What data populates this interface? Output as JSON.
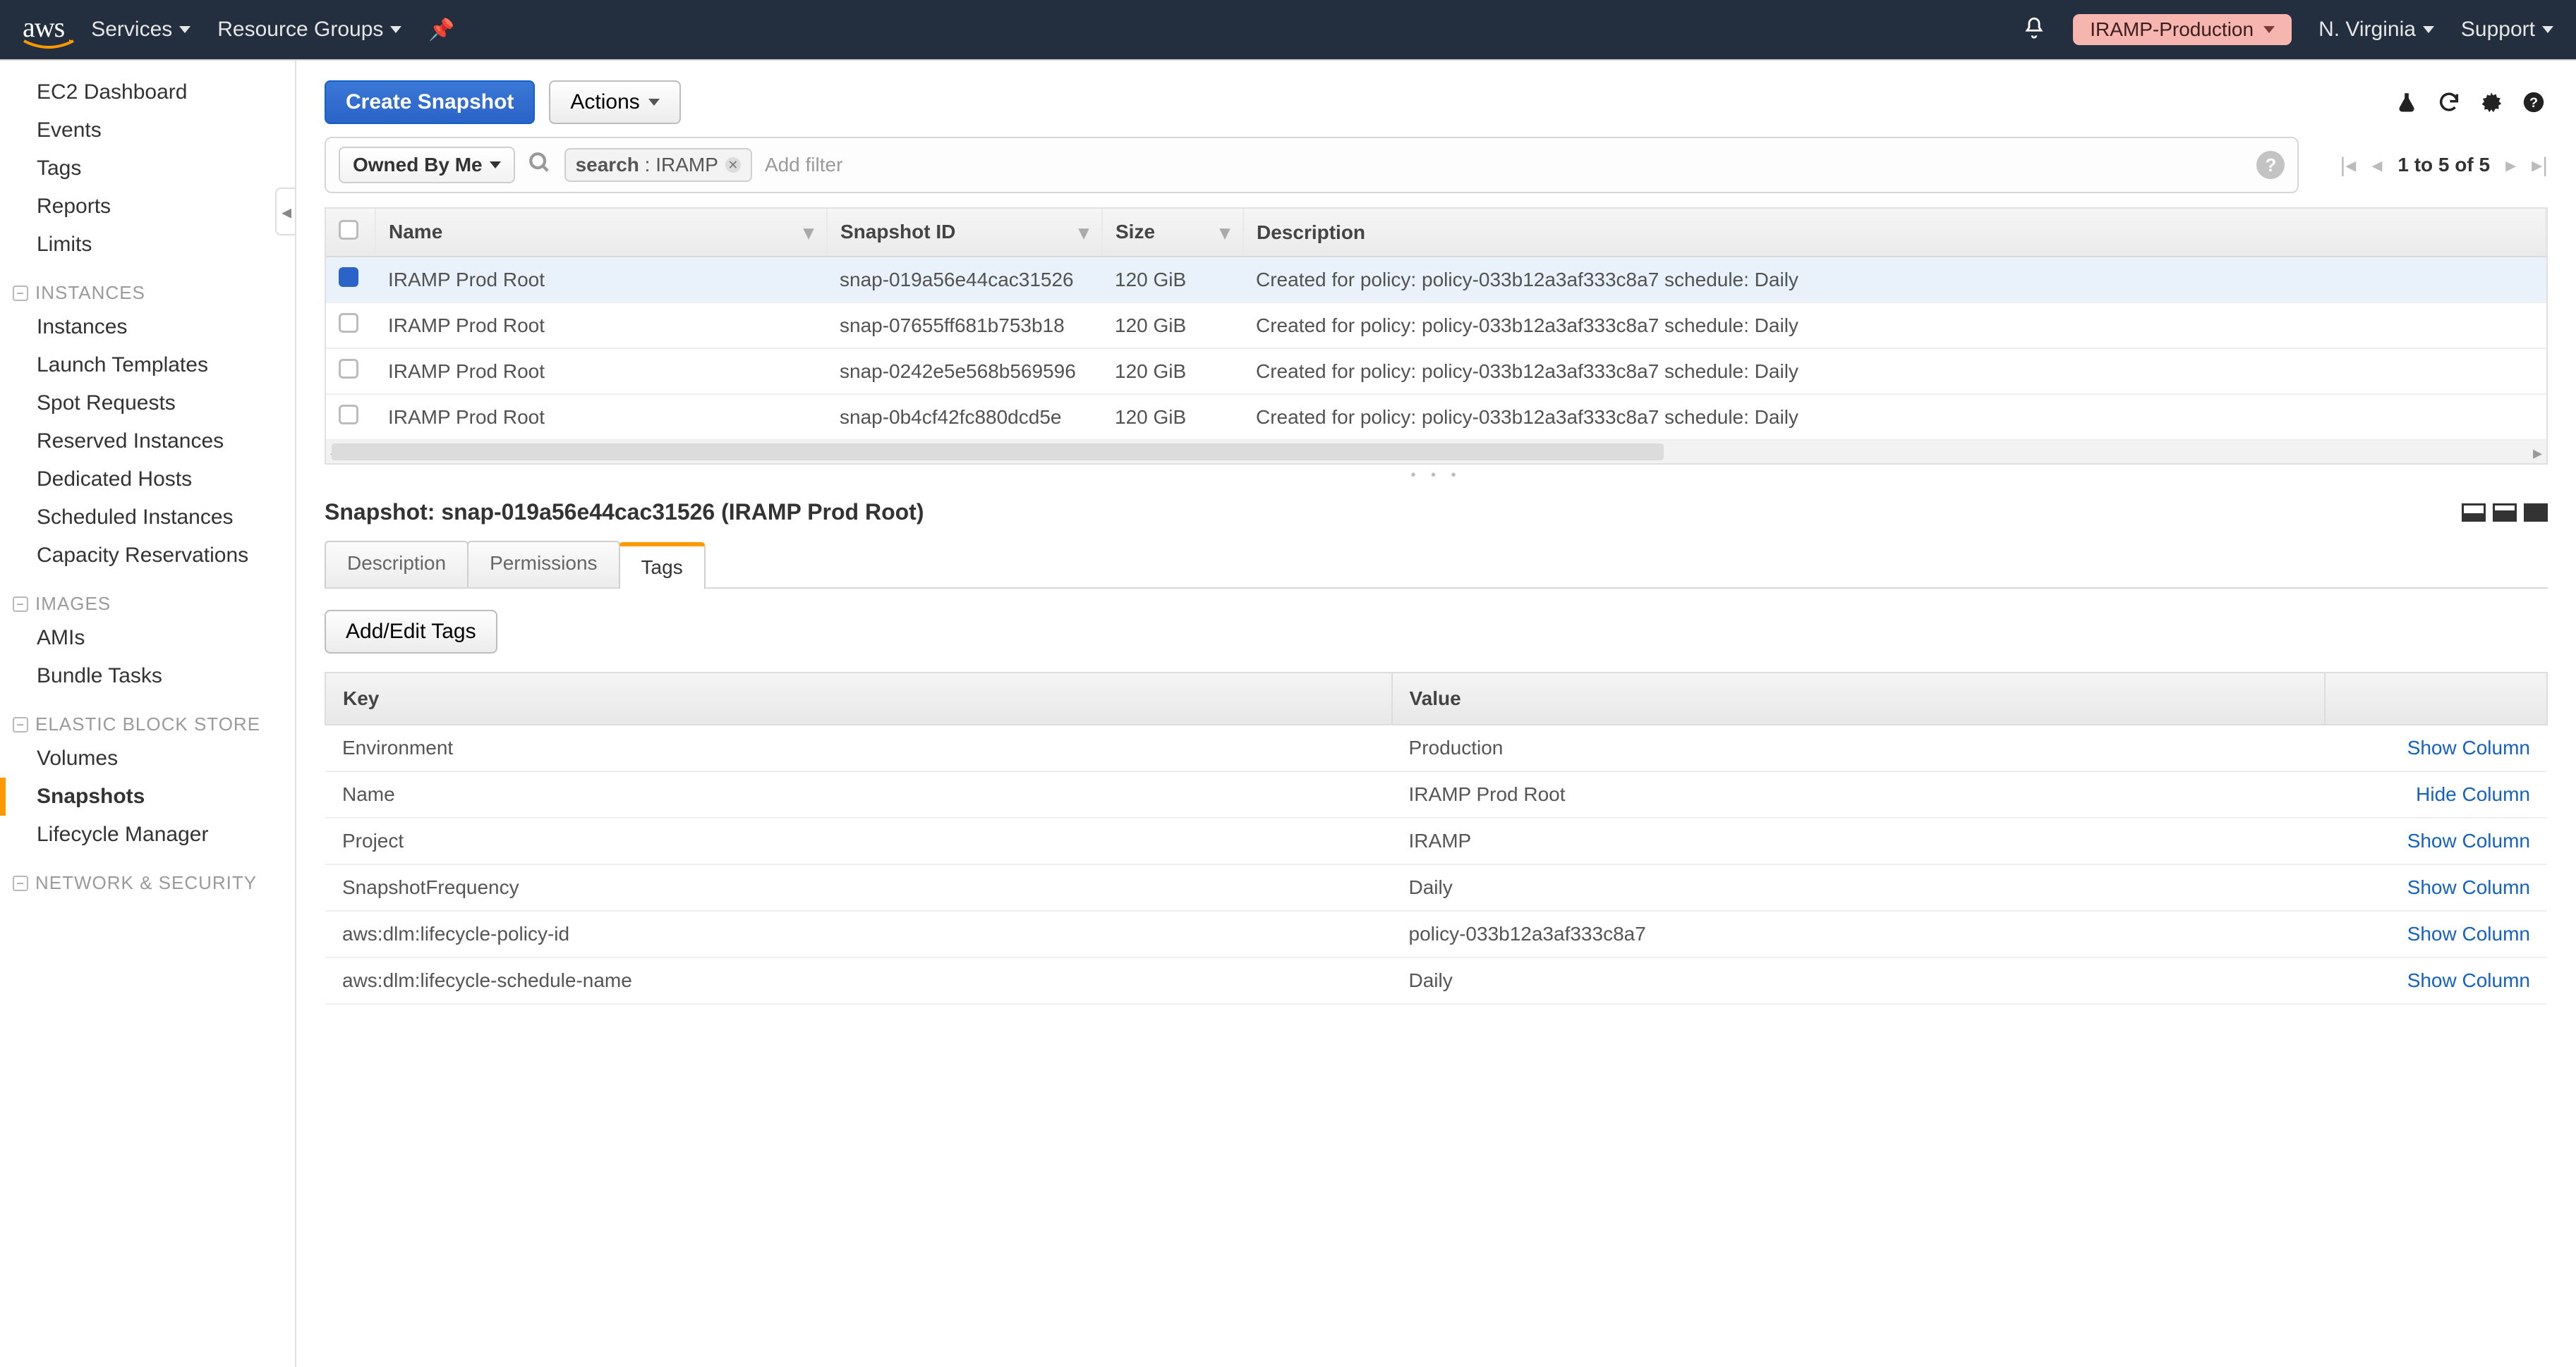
{
  "topnav": {
    "logo_text": "aws",
    "services": "Services",
    "resource_groups": "Resource Groups",
    "env_pill": "IRAMP-Production",
    "region": "N. Virginia",
    "support": "Support"
  },
  "sidebar": {
    "top": [
      "EC2 Dashboard",
      "Events",
      "Tags",
      "Reports",
      "Limits"
    ],
    "groups": [
      {
        "title": "INSTANCES",
        "items": [
          "Instances",
          "Launch Templates",
          "Spot Requests",
          "Reserved Instances",
          "Dedicated Hosts",
          "Scheduled Instances",
          "Capacity Reservations"
        ]
      },
      {
        "title": "IMAGES",
        "items": [
          "AMIs",
          "Bundle Tasks"
        ]
      },
      {
        "title": "ELASTIC BLOCK STORE",
        "items": [
          "Volumes",
          "Snapshots",
          "Lifecycle Manager"
        ]
      },
      {
        "title": "NETWORK & SECURITY",
        "items": []
      }
    ],
    "active": "Snapshots"
  },
  "actions": {
    "create": "Create Snapshot",
    "actions": "Actions"
  },
  "filter": {
    "owned": "Owned By Me",
    "search_label": "search",
    "search_value": "IRAMP",
    "add_filter": "Add filter",
    "pagination": "1 to 5 of 5"
  },
  "table": {
    "columns": [
      "Name",
      "Snapshot ID",
      "Size",
      "Description"
    ],
    "rows": [
      {
        "selected": true,
        "name": "IRAMP Prod Root",
        "id": "snap-019a56e44cac31526",
        "size": "120 GiB",
        "desc": "Created for policy: policy-033b12a3af333c8a7 schedule: Daily"
      },
      {
        "selected": false,
        "name": "IRAMP Prod Root",
        "id": "snap-07655ff681b753b18",
        "size": "120 GiB",
        "desc": "Created for policy: policy-033b12a3af333c8a7 schedule: Daily"
      },
      {
        "selected": false,
        "name": "IRAMP Prod Root",
        "id": "snap-0242e5e568b569596",
        "size": "120 GiB",
        "desc": "Created for policy: policy-033b12a3af333c8a7 schedule: Daily"
      },
      {
        "selected": false,
        "name": "IRAMP Prod Root",
        "id": "snap-0b4cf42fc880dcd5e",
        "size": "120 GiB",
        "desc": "Created for policy: policy-033b12a3af333c8a7 schedule: Daily"
      }
    ]
  },
  "detail": {
    "title": "Snapshot: snap-019a56e44cac31526 (IRAMP Prod Root)",
    "tabs": [
      "Description",
      "Permissions",
      "Tags"
    ],
    "active_tab": "Tags",
    "add_edit": "Add/Edit Tags",
    "tag_headers": {
      "key": "Key",
      "value": "Value"
    },
    "show_label": "Show Column",
    "hide_label": "Hide Column",
    "tags": [
      {
        "k": "Environment",
        "v": "Production",
        "action": "show"
      },
      {
        "k": "Name",
        "v": "IRAMP Prod Root",
        "action": "hide"
      },
      {
        "k": "Project",
        "v": "IRAMP",
        "action": "show"
      },
      {
        "k": "SnapshotFrequency",
        "v": "Daily",
        "action": "show"
      },
      {
        "k": "aws:dlm:lifecycle-policy-id",
        "v": "policy-033b12a3af333c8a7",
        "action": "show"
      },
      {
        "k": "aws:dlm:lifecycle-schedule-name",
        "v": "Daily",
        "action": "show"
      }
    ]
  }
}
